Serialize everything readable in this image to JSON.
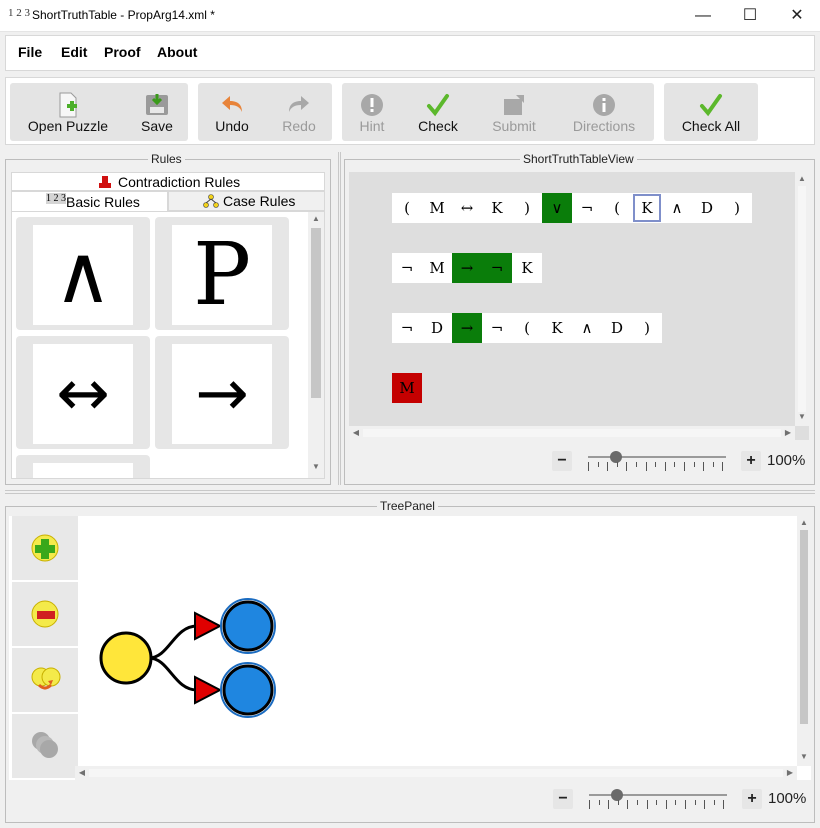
{
  "window": {
    "app_icon_text": "1 2 3",
    "title": "ShortTruthTable - PropArg14.xml *",
    "minimize": "—",
    "maximize": "☐",
    "close": "✕"
  },
  "menu": [
    "File",
    "Edit",
    "Proof",
    "About"
  ],
  "toolbar": {
    "open_puzzle": "Open Puzzle",
    "save": "Save",
    "undo": "Undo",
    "redo": "Redo",
    "hint": "Hint",
    "check": "Check",
    "submit": "Submit",
    "directions": "Directions",
    "check_all": "Check All"
  },
  "rules_panel": {
    "title": "Rules",
    "tab_contradiction": "Contradiction Rules",
    "tab_basic": "Basic Rules",
    "tab_case": "Case Rules",
    "tab_basic_icon": "1 2 3",
    "tiles": [
      "∧",
      "P",
      "↔",
      "→"
    ]
  },
  "view_panel": {
    "title": "ShortTruthTableView",
    "rows": [
      [
        "(",
        "M",
        "↔",
        "K",
        ")",
        "∨",
        "¬",
        "(",
        "K",
        "∧",
        "D",
        ")"
      ],
      [
        "¬",
        "M",
        "→",
        "¬",
        "K"
      ],
      [
        "¬",
        "D",
        "→",
        "¬",
        "(",
        "K",
        "∧",
        "D",
        ")"
      ],
      [
        "M"
      ]
    ],
    "zoom_minus": "−",
    "zoom_plus": "+",
    "zoom": "100%"
  },
  "tree_panel": {
    "title": "TreePanel",
    "zoom_minus": "−",
    "zoom_plus": "+",
    "zoom": "100%"
  },
  "colors": {
    "true_cell": "#0a7d0a",
    "false_cell": "#c40000",
    "selected_outline": "#7f8fca",
    "root_node": "#ffe63a",
    "child_node": "#1f86e0",
    "branch_arrow": "#e00000"
  }
}
